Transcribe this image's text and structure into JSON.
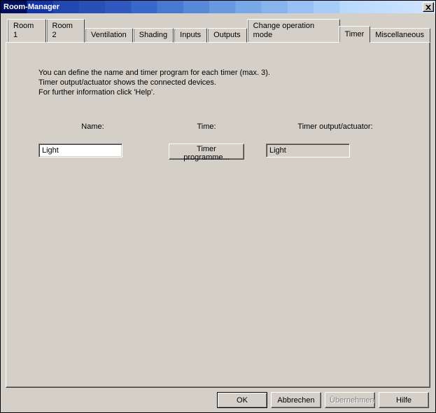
{
  "window": {
    "title": "Room-Manager"
  },
  "tabs": [
    {
      "label": "Room 1"
    },
    {
      "label": "Room 2"
    },
    {
      "label": "Ventilation"
    },
    {
      "label": "Shading"
    },
    {
      "label": "Inputs"
    },
    {
      "label": "Outputs"
    },
    {
      "label": "Change operation mode"
    },
    {
      "label": "Timer"
    },
    {
      "label": "Miscellaneous"
    }
  ],
  "active_tab_index": 7,
  "intro": {
    "line1": "You can define the name and timer program for each timer (max. 3).",
    "line2": "Timer output/actuator shows the connected devices.",
    "line3": "For further information click 'Help'."
  },
  "columns": {
    "name": {
      "header": "Name:",
      "value": "Light"
    },
    "time": {
      "header": "Time:",
      "button": "Timer programme..."
    },
    "output": {
      "header": "Timer output/actuator:",
      "value": "Light"
    }
  },
  "buttons": {
    "ok": "OK",
    "cancel": "Abbrechen",
    "apply": "Übernehmen",
    "help": "Hilfe"
  }
}
